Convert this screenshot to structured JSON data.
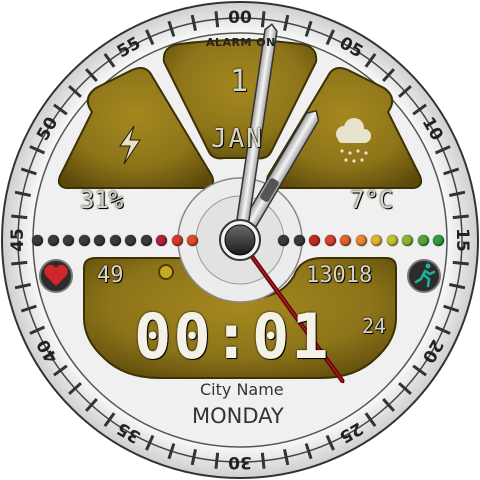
{
  "bezel": {
    "numerals": [
      "00",
      "05",
      "10",
      "15",
      "20",
      "25",
      "30",
      "35",
      "40",
      "45",
      "50",
      "55"
    ]
  },
  "alarm_label": "ALARM ON",
  "date": {
    "day": "1",
    "month": "JAN"
  },
  "battery": {
    "value": "31%",
    "icon": "lightning-icon"
  },
  "weather": {
    "temperature": "7°C",
    "icon": "cloud-rain-icon"
  },
  "heart_rate": {
    "value": "49",
    "icon": "heart-icon"
  },
  "steps": {
    "value": "13018",
    "icon": "running-person-icon"
  },
  "time": {
    "hours_minutes": "00:01",
    "seconds": "24"
  },
  "city": "City Name",
  "weekday": "MONDAY",
  "colors": {
    "panel_gold": "#8d7419",
    "panel_dark": "#5f4c0c",
    "frame_white": "#f2f2f2",
    "heart_red": "#d3252c",
    "steps_teal": "#1c9b8a",
    "second_hand": "#c3121d"
  },
  "progress_dots_left": [
    "#3a3a3a",
    "#3a3a3a",
    "#3a3a3a",
    "#3a3a3a",
    "#3a3a3a",
    "#3a3a3a",
    "#3a3a3a",
    "#3a3a3a",
    "#b3203a",
    "#d03a2b",
    "#e14b25"
  ],
  "progress_dots_right": [
    "#3a3a3a",
    "#3a3a3a",
    "#c02b1e",
    "#d5402a",
    "#e0632a",
    "#e9872c",
    "#e3b12e",
    "#c2c22e",
    "#86b52d",
    "#4fa73a",
    "#2f9d3a"
  ],
  "hands": {
    "hour": 1,
    "minute": 1,
    "second": 24
  }
}
